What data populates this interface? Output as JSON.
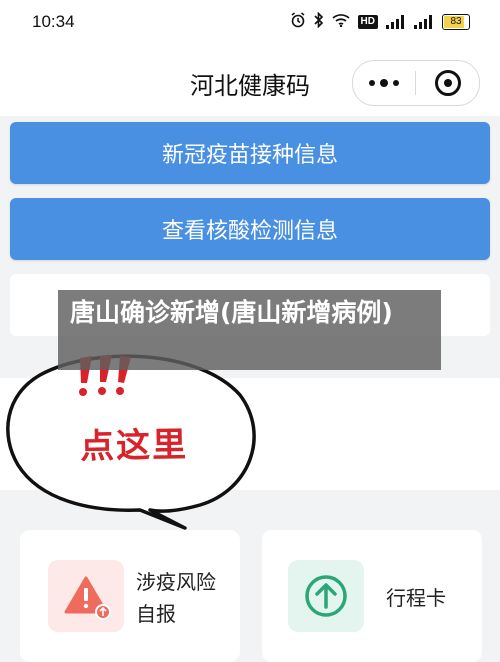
{
  "status_bar": {
    "time": "10:34",
    "network_badge": "HD",
    "signal_1_label": "5G",
    "signal_2_label": "5G",
    "battery": "83",
    "icons": [
      "alarm-icon",
      "bluetooth-icon",
      "wifi-icon",
      "signal-icon",
      "battery-icon"
    ]
  },
  "header": {
    "title": "河北健康码",
    "more_icon": "more-dots-icon",
    "close_icon": "target-close-icon"
  },
  "menu": {
    "vaccine_label": "新冠疫苗接种信息",
    "nucleic_label": "查看核酸检测信息"
  },
  "overlay": {
    "text": "唐山确诊新增(唐山新增病例)"
  },
  "speech_bubble": {
    "exclaim": "!!!",
    "text": "点这里"
  },
  "cards": {
    "risk_label": "涉疫风险自报",
    "trip_label": "行程卡"
  },
  "colors": {
    "button_blue": "#4a90e2",
    "bubble_red": "#d8232a",
    "risk_icon": "#ee6b5e",
    "trip_icon": "#2aa776"
  }
}
